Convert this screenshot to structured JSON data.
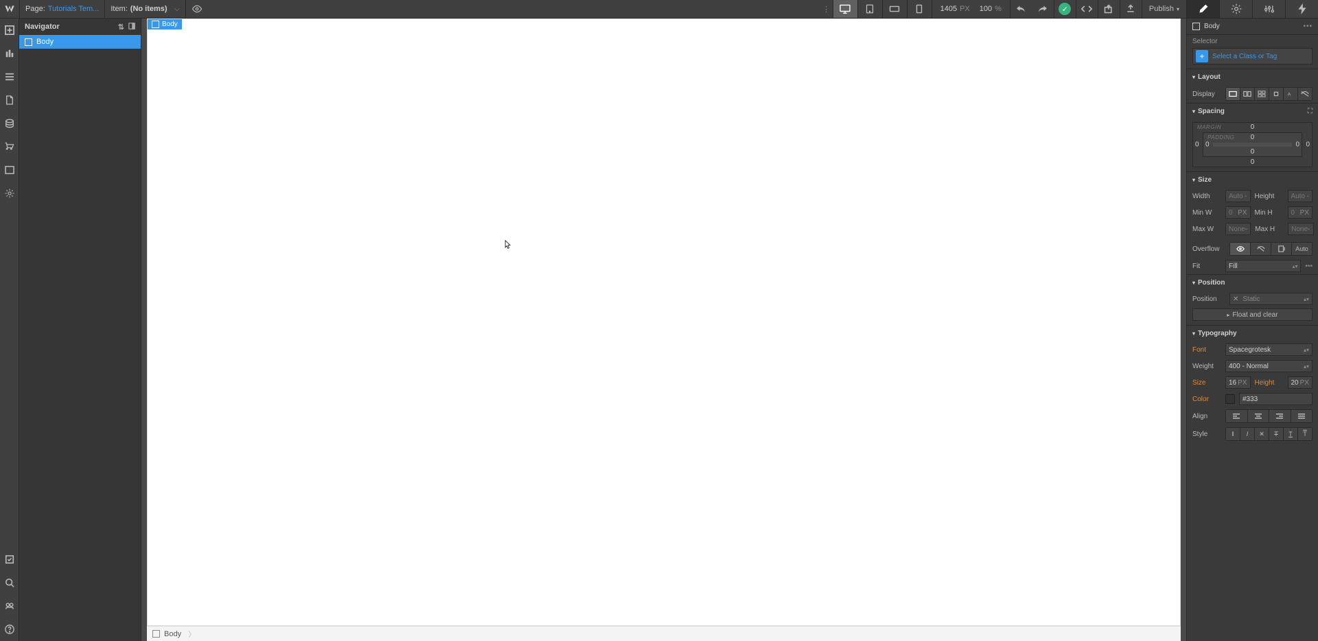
{
  "topbar": {
    "page_label": "Page:",
    "page_value": "Tutorials Tem...",
    "item_label": "Item:",
    "item_value": "(No items)",
    "canvas_width": "1405",
    "canvas_width_unit": "PX",
    "zoom_value": "100",
    "zoom_unit": "%",
    "publish_label": "Publish"
  },
  "navigator": {
    "title": "Navigator",
    "items": [
      "Body"
    ]
  },
  "canvas": {
    "selected_badge": "Body",
    "breadcrumb": "Body"
  },
  "stylepanel": {
    "element_label": "Body",
    "selector_label": "Selector",
    "selector_hint": "Select a Class or Tag",
    "sections": {
      "layout": {
        "title": "Layout",
        "display_label": "Display"
      },
      "spacing": {
        "title": "Spacing",
        "margin_label": "MARGIN",
        "padding_label": "PADDING",
        "margin": {
          "top": "0",
          "right": "0",
          "bottom": "0",
          "left": "0"
        },
        "padding": {
          "top": "0",
          "right": "0",
          "bottom": "0",
          "left": "0"
        }
      },
      "size": {
        "title": "Size",
        "width_label": "Width",
        "width_value": "Auto",
        "height_label": "Height",
        "height_value": "Auto",
        "minw_label": "Min W",
        "minw_value": "0",
        "minw_unit": "PX",
        "minh_label": "Min H",
        "minh_value": "0",
        "minh_unit": "PX",
        "maxw_label": "Max W",
        "maxw_value": "None",
        "maxh_label": "Max H",
        "maxh_value": "None",
        "overflow_label": "Overflow",
        "overflow_auto": "Auto",
        "fit_label": "Fit",
        "fit_value": "Fill"
      },
      "position": {
        "title": "Position",
        "position_label": "Position",
        "position_value": "Static",
        "float_label": "Float and clear"
      },
      "typography": {
        "title": "Typography",
        "font_label": "Font",
        "font_value": "Spacegrotesk",
        "weight_label": "Weight",
        "weight_value": "400 - Normal",
        "size_label": "Size",
        "size_value": "16",
        "size_unit": "PX",
        "height_label": "Height",
        "height_value": "20",
        "height_unit": "PX",
        "color_label": "Color",
        "color_value": "#333",
        "align_label": "Align",
        "style_label": "Style"
      }
    }
  }
}
